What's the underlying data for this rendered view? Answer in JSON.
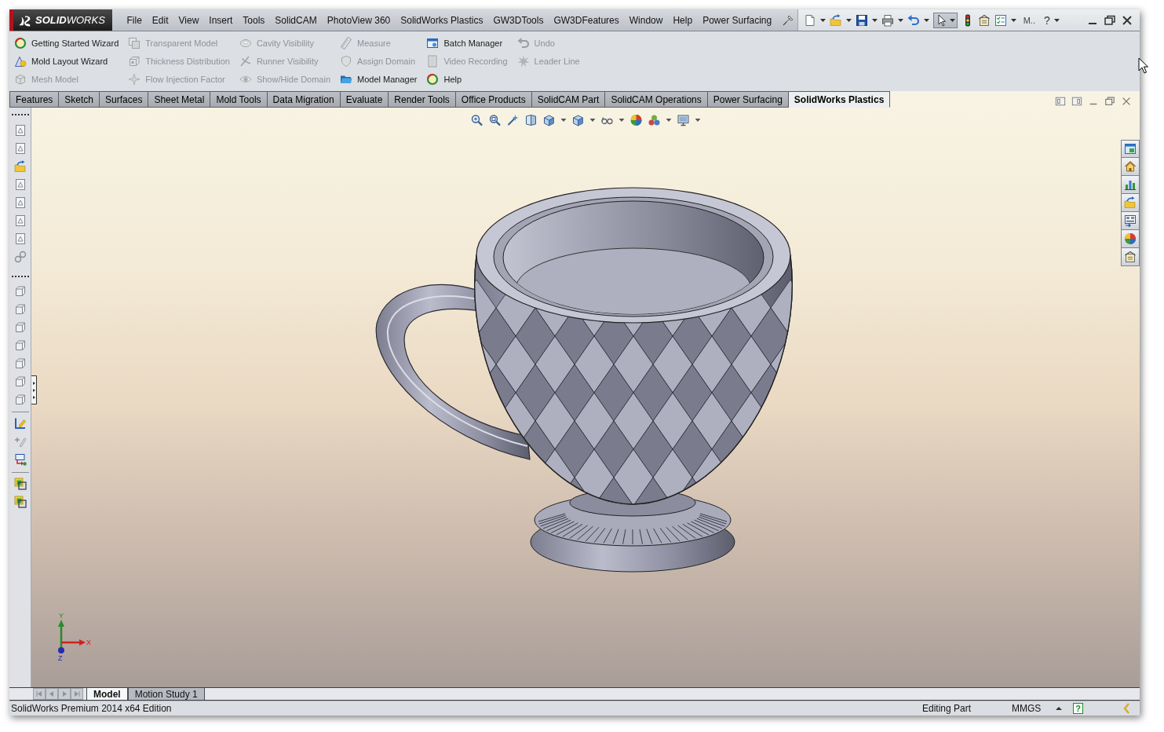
{
  "app_bar": {
    "logo": "**SOLID**WORKS",
    "menu": [
      "File",
      "Edit",
      "View",
      "Insert",
      "Tools",
      "SolidCAM",
      "PhotoView 360",
      "SolidWorks Plastics",
      "GW3DTools",
      "GW3DFeatures",
      "Window",
      "Help",
      "Power Surfacing"
    ],
    "quick_access": {
      "select_active": true,
      "more_label": "M..",
      "help_glyph": "?"
    }
  },
  "ribbon": {
    "columns": [
      [
        {
          "label": "Getting Started Wizard",
          "disabled": false
        },
        {
          "label": "Mold Layout Wizard",
          "disabled": false
        },
        {
          "label": "Mesh Model",
          "disabled": true
        }
      ],
      [
        {
          "label": "Transparent Model",
          "disabled": true
        },
        {
          "label": "Thickness Distribution",
          "disabled": true
        },
        {
          "label": "Flow Injection Factor",
          "disabled": true
        }
      ],
      [
        {
          "label": "Cavity Visibility",
          "disabled": true
        },
        {
          "label": "Runner Visibility",
          "disabled": true
        },
        {
          "label": "Show/Hide Domain",
          "disabled": true
        }
      ],
      [
        {
          "label": "Measure",
          "disabled": true
        },
        {
          "label": "Assign Domain",
          "disabled": true
        },
        {
          "label": "Model Manager",
          "disabled": false
        }
      ],
      [
        {
          "label": "Batch Manager",
          "disabled": false
        },
        {
          "label": "Video Recording",
          "disabled": true
        },
        {
          "label": "Help",
          "disabled": false
        }
      ],
      [
        {
          "label": "Undo",
          "disabled": true
        },
        {
          "label": "Leader Line",
          "disabled": true
        }
      ]
    ]
  },
  "command_tabs": [
    {
      "label": "Features",
      "selected": false
    },
    {
      "label": "Sketch",
      "selected": false
    },
    {
      "label": "Surfaces",
      "selected": false
    },
    {
      "label": "Sheet Metal",
      "selected": false
    },
    {
      "label": "Mold Tools",
      "selected": false
    },
    {
      "label": "Data Migration",
      "selected": false
    },
    {
      "label": "Evaluate",
      "selected": false
    },
    {
      "label": "Render Tools",
      "selected": false
    },
    {
      "label": "Office Products",
      "selected": false
    },
    {
      "label": "SolidCAM Part",
      "selected": false
    },
    {
      "label": "SolidCAM Operations",
      "selected": false
    },
    {
      "label": "Power Surfacing",
      "selected": false
    },
    {
      "label": "SolidWorks Plastics",
      "selected": true
    }
  ],
  "viewport": {
    "triad": {
      "y_label": "Y",
      "x_label": "X",
      "z_label": "Z"
    }
  },
  "document_tabs": [
    {
      "label": "Model",
      "selected": true
    },
    {
      "label": "Motion Study 1",
      "selected": false
    }
  ],
  "status_bar": {
    "edition": "SolidWorks Premium 2014 x64 Edition",
    "mode": "Editing Part",
    "units": "MMGS",
    "help_glyph": "?"
  }
}
